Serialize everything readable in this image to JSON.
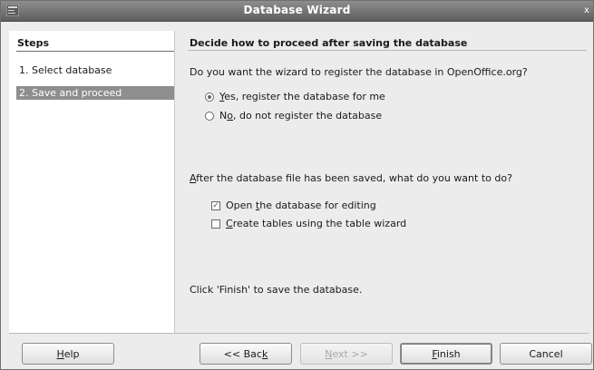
{
  "window": {
    "title": "Database Wizard",
    "close_glyph": "x"
  },
  "steps": {
    "header": "Steps",
    "items": [
      {
        "label": "1. Select database",
        "selected": false
      },
      {
        "label": "2. Save and proceed",
        "selected": true
      }
    ]
  },
  "page": {
    "heading": "Decide how to proceed after saving the database",
    "register_question": "Do you want the wizard to register the database in OpenOffice.org?",
    "register_options": [
      {
        "prefix": "",
        "mnemonic": "Y",
        "rest": "es, register the database for me",
        "checked": true
      },
      {
        "prefix": "N",
        "mnemonic": "o",
        "rest": ", do not register the database",
        "checked": false
      }
    ],
    "after_save_question": {
      "mnemonic": "A",
      "rest": "fter the database file has been saved, what do you want to do?"
    },
    "after_save_options": [
      {
        "prefix": "Open ",
        "mnemonic": "t",
        "rest": "he database for editing",
        "checked": true
      },
      {
        "prefix": "",
        "mnemonic": "C",
        "rest": "reate tables using the table wizard",
        "checked": false
      }
    ],
    "finish_hint": "Click 'Finish' to save the database."
  },
  "buttons": {
    "help": {
      "mnemonic": "H",
      "rest": "elp"
    },
    "back": {
      "prefix": "<< Bac",
      "mnemonic": "k",
      "rest": ""
    },
    "next": {
      "mnemonic": "N",
      "rest": "ext >>"
    },
    "finish": {
      "mnemonic": "F",
      "rest": "inish"
    },
    "cancel": {
      "label": "Cancel"
    }
  },
  "icons": {
    "app_icon": "window-menu-icon",
    "check_glyph": "✓"
  },
  "colors": {
    "titlebar": "#6f6f6f",
    "selected_step": "#8e8e8e",
    "pane_bg": "#ececec"
  }
}
